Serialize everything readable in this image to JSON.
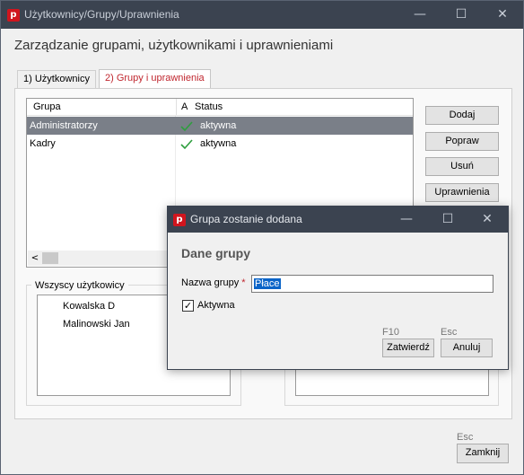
{
  "window": {
    "title": "Użytkownicy/Grupy/Uprawnienia",
    "app_icon_letter": "p",
    "minimize_glyph": "—",
    "maximize_glyph": "☐",
    "close_glyph": "✕"
  },
  "page_title": "Zarządzanie grupami, użytkownikami i uprawnieniami",
  "tabs": [
    {
      "label": "1) Użytkownicy",
      "active": false
    },
    {
      "label": "2) Grupy i uprawnienia",
      "active": true
    }
  ],
  "groups_table": {
    "columns": [
      "Grupa",
      "A",
      "Status"
    ],
    "rows": [
      {
        "group": "Administratorzy",
        "status": "aktywna",
        "selected": true
      },
      {
        "group": "Kadry",
        "status": "aktywna",
        "selected": false
      }
    ],
    "scroll_left_glyph": "<"
  },
  "side_buttons": {
    "add": "Dodaj",
    "edit": "Popraw",
    "delete": "Usuń",
    "permissions": "Uprawnienia"
  },
  "all_users": {
    "legend": "Wszyscy użytkowicy",
    "items": [
      "Kowalska D",
      "Malinowski Jan"
    ]
  },
  "footer": {
    "shortcut": "Esc",
    "close_button": "Zamknij"
  },
  "dialog": {
    "title": "Grupa zostanie dodana",
    "heading": "Dane grupy",
    "name_label": "Nazwa grupy",
    "required_mark": "*",
    "name_value": "Płace",
    "active_label": "Aktywna",
    "active_checked": true,
    "confirm_shortcut": "F10",
    "confirm_button": "Zatwierdź",
    "cancel_shortcut": "Esc",
    "cancel_button": "Anuluj"
  },
  "colors": {
    "titlebar": "#3b4350",
    "accent_red": "#c0262e",
    "selection": "#7a7f88",
    "check_green": "#2e9e3e"
  }
}
